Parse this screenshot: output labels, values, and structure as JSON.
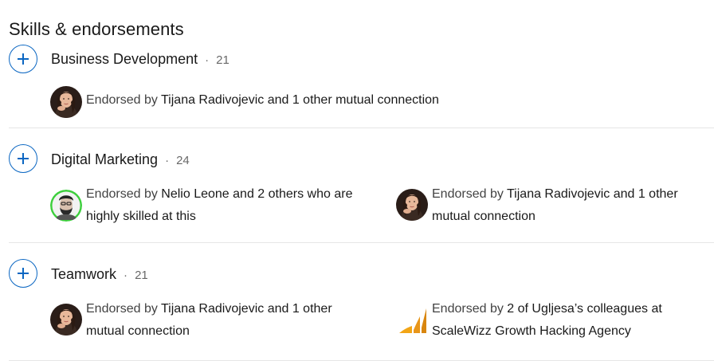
{
  "section": {
    "title": "Skills & endorsements"
  },
  "colors": {
    "accent": "#0a66c2",
    "separator": "#e6e6e6"
  },
  "skills": [
    {
      "name": "Business Development",
      "separator": "·",
      "count": "21",
      "endorsements": [
        {
          "avatar": "female-avatar",
          "prefix": "Endorsed by",
          "who": "Tijana Radivojevic and 1 other mutual connection",
          "who_line2": ""
        }
      ]
    },
    {
      "name": "Digital Marketing",
      "separator": "·",
      "count": "24",
      "endorsements": [
        {
          "avatar": "male-avatar-green-ring",
          "prefix": "Endorsed by",
          "who": "Nelio Leone and 2 others who are",
          "who_line2": "highly skilled at this"
        },
        {
          "avatar": "female-avatar",
          "prefix": "Endorsed by",
          "who": "Tijana Radivojevic and 1 other",
          "who_line2": "mutual connection"
        }
      ]
    },
    {
      "name": "Teamwork",
      "separator": "·",
      "count": "21",
      "endorsements": [
        {
          "avatar": "female-avatar",
          "prefix": "Endorsed by",
          "who": "Tijana Radivojevic and 1 other",
          "who_line2": "mutual connection"
        },
        {
          "avatar": "company-logo",
          "prefix": "Endorsed by",
          "who": "2 of Ugljesa’s colleagues at",
          "who_line2": "ScaleWizz Growth Hacking Agency"
        }
      ]
    }
  ]
}
